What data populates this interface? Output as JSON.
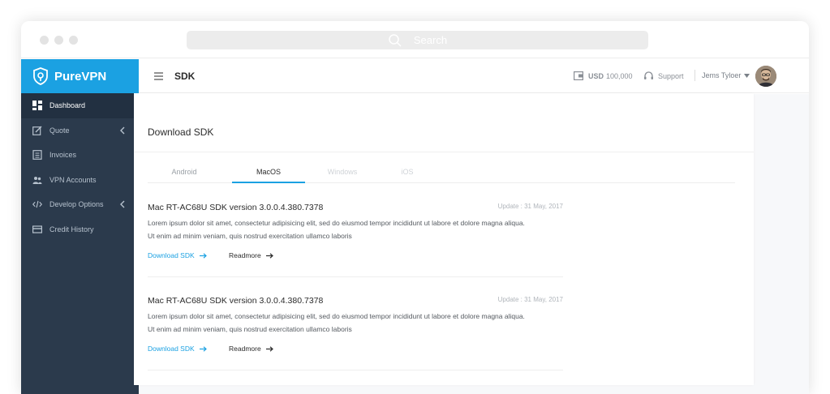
{
  "browser": {
    "search_placeholder": "Search"
  },
  "brand": {
    "name": "PureVPN"
  },
  "sidebar": {
    "items": [
      {
        "label": "Dashboard",
        "icon": "dashboard-icon"
      },
      {
        "label": "Quote",
        "icon": "edit-icon"
      },
      {
        "label": "Invoices",
        "icon": "invoice-icon"
      },
      {
        "label": "VPN Accounts",
        "icon": "users-icon"
      },
      {
        "label": "Develop Options",
        "icon": "code-icon"
      },
      {
        "label": "Credit History",
        "icon": "card-icon"
      }
    ]
  },
  "header": {
    "title": "SDK",
    "balance_currency": "USD",
    "balance_amount": "100,000",
    "support_label": "Support",
    "user_name": "Jems Tyloer"
  },
  "main": {
    "card_title": "Download SDK",
    "tabs": [
      {
        "label": "Android"
      },
      {
        "label": "MacOS"
      },
      {
        "label": "Windows"
      },
      {
        "label": "iOS"
      }
    ],
    "sdks": [
      {
        "title": "Mac RT-AC68U SDK version 3.0.0.4.380.7378",
        "date": "Update : 31 May, 2017",
        "line1": "Lorem ipsum dolor sit amet, consectetur adipisicing elit, sed do eiusmod tempor incididunt ut labore et dolore magna aliqua.",
        "line2": "Ut enim ad minim veniam, quis nostrud exercitation ullamco laboris",
        "download_label": "Download SDK",
        "readmore_label": "Readmore"
      },
      {
        "title": "Mac RT-AC68U SDK version 3.0.0.4.380.7378",
        "date": "Update : 31 May, 2017",
        "line1": "Lorem ipsum dolor sit amet, consectetur adipisicing elit, sed do eiusmod tempor incididunt ut labore et dolore magna aliqua.",
        "line2": "Ut enim ad minim veniam, quis nostrud exercitation ullamco laboris",
        "download_label": "Download SDK",
        "readmore_label": "Readmore"
      }
    ]
  },
  "colors": {
    "accent": "#1ba1e2",
    "sidebar": "#2b3a4c"
  }
}
